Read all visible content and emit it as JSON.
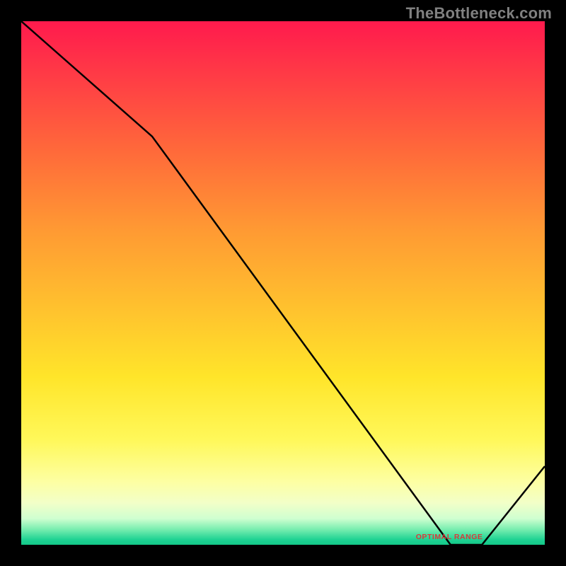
{
  "watermark": "TheBottleneck.com",
  "optimal_label": "OPTIMAL RANGE",
  "colors": {
    "background_frame": "#000000",
    "curve": "#000000",
    "watermark": "#808080",
    "label": "#d83a3a",
    "gradient_top": "#ff1a4d",
    "gradient_bottom": "#14c989"
  },
  "chart_data": {
    "type": "line",
    "title": "",
    "xlabel": "",
    "ylabel": "",
    "x": [
      0,
      25,
      82,
      88,
      100
    ],
    "values": [
      100,
      78,
      0,
      0,
      15
    ],
    "xlim": [
      0,
      100
    ],
    "ylim": [
      0,
      100
    ],
    "optimal_range_x": [
      82,
      88
    ],
    "annotations": [
      {
        "text": "OPTIMAL RANGE",
        "x": 85,
        "y": 0
      }
    ],
    "background_gradient": {
      "direction": "vertical",
      "stops": [
        {
          "pos": 0.0,
          "color": "#ff1a4d"
        },
        {
          "pos": 0.55,
          "color": "#ffc22e"
        },
        {
          "pos": 0.88,
          "color": "#fdffa3"
        },
        {
          "pos": 1.0,
          "color": "#14c989"
        }
      ]
    }
  }
}
